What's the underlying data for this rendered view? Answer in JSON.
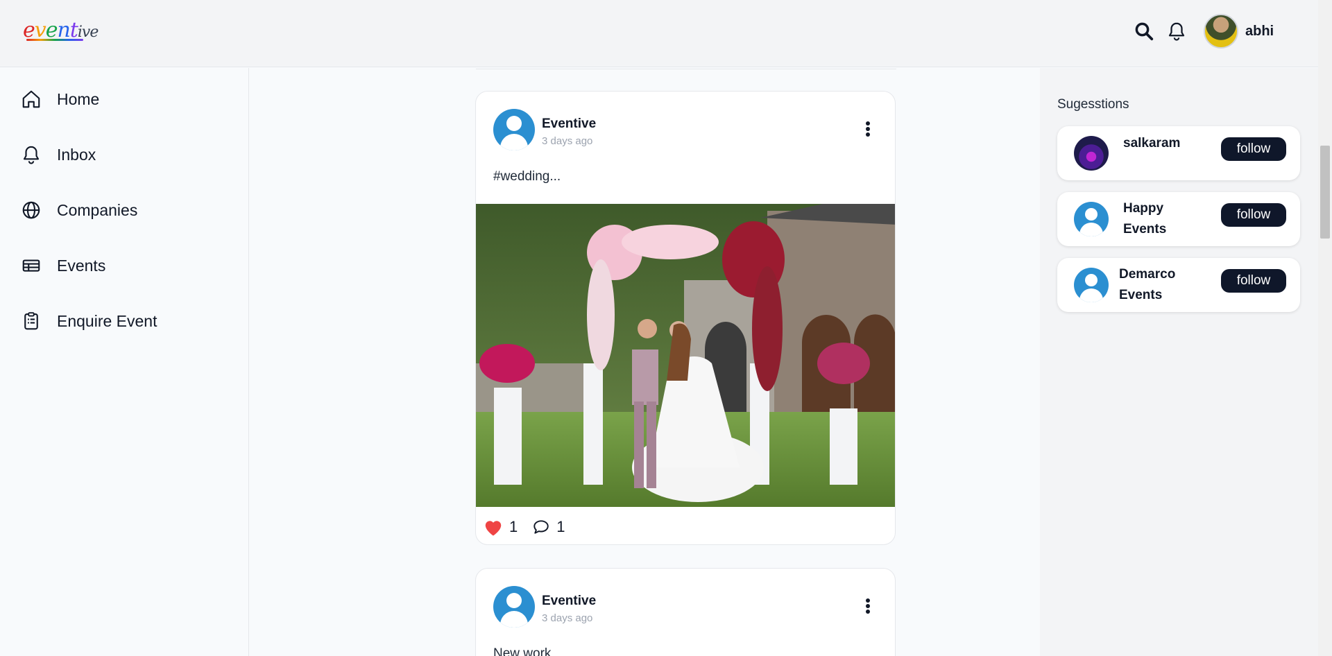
{
  "header": {
    "logo_text": "eventive",
    "username": "abhi",
    "icons": [
      "search-icon",
      "bell-icon"
    ]
  },
  "sidebar": {
    "items": [
      {
        "label": "Home",
        "icon": "home-icon"
      },
      {
        "label": "Inbox",
        "icon": "bell-icon"
      },
      {
        "label": "Companies",
        "icon": "globe-icon"
      },
      {
        "label": "Events",
        "icon": "ticket-icon"
      },
      {
        "label": "Enquire Event",
        "icon": "clipboard-icon"
      }
    ]
  },
  "feed": {
    "posts": [
      {
        "author": "Eventive",
        "time": "3 days ago",
        "caption": "#wedding...",
        "image": "wedding-couple-flower-arch-photo",
        "likes": "1",
        "comments": "1"
      },
      {
        "author": "Eventive",
        "time": "3 days ago",
        "caption": "New work"
      }
    ]
  },
  "suggestions": {
    "title": "Sugesstions",
    "items": [
      {
        "name": "salkaram",
        "button": "follow"
      },
      {
        "name": "Happy Events",
        "button": "follow"
      },
      {
        "name": "Demarco Events",
        "button": "follow"
      }
    ]
  },
  "colors": {
    "accent_dark": "#0f172a",
    "avatar_blue": "#2b8fd1",
    "heart_red": "#ef4444"
  }
}
